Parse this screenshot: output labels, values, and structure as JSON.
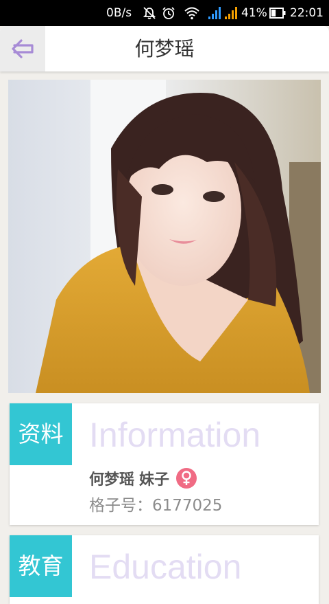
{
  "status_bar": {
    "net_speed": "0B/s",
    "battery_percent": "41%",
    "battery_level": 0.41,
    "time": "22:01"
  },
  "header": {
    "title": "何梦瑶",
    "back_icon": "back-arrow-icon",
    "accent_color": "#a78bd6"
  },
  "profile": {
    "photo_icon": "profile-photo"
  },
  "info_card": {
    "tag": "资料",
    "heading": "Information",
    "name": "何梦瑶",
    "category": "妹子",
    "gender_icon": "female-icon",
    "id_text": "格子号：6177025"
  },
  "education_card": {
    "tag": "教育",
    "heading": "Education"
  },
  "colors": {
    "tag_bg": "#33c6d3",
    "heading_text": "#e3dcf3",
    "gender_badge": "#f06b84"
  }
}
